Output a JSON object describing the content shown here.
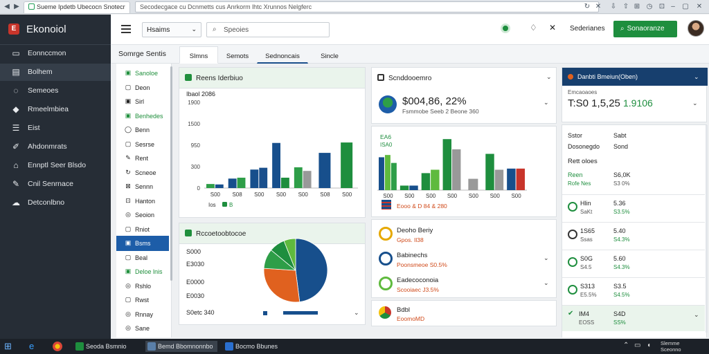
{
  "browser": {
    "tab_title": "Sueme Ipdetb Ubecocn Snotecr",
    "url": "Secodecgace cu Dcnmetts cus Anrkorm lhtc Xrunnos Nelgferc"
  },
  "sidebar": {
    "brand": "Ekonoiol",
    "items": [
      {
        "icon": "dashboard-icon",
        "glyph": "▭",
        "label": "Eonnccmon"
      },
      {
        "icon": "folder-icon",
        "glyph": "▤",
        "label": "Bolhem"
      },
      {
        "icon": "chat-icon",
        "glyph": "◌",
        "label": "Semeoes"
      },
      {
        "icon": "chart-icon",
        "glyph": "◆",
        "label": "Rmeelmbiea"
      },
      {
        "icon": "list-icon",
        "glyph": "☰",
        "label": "Eist"
      },
      {
        "icon": "rocket-icon",
        "glyph": "✐",
        "label": "Ahdonmrats"
      },
      {
        "icon": "car-icon",
        "glyph": "⌂",
        "label": "Ennptl Seer Blsdo"
      },
      {
        "icon": "pen-icon",
        "glyph": "✎",
        "label": "Cnil Senrnace"
      },
      {
        "icon": "cloud-icon",
        "glyph": "☁",
        "label": "Detconlbno"
      }
    ]
  },
  "topbar": {
    "select_value": "Hsaims",
    "search_placeholder": "Speoies",
    "label": "Sederianes",
    "button_label": "Sonaoranze"
  },
  "page": {
    "title": "Somrge Sentis",
    "tabs": [
      "Slmns",
      "Semots",
      "Sednoncais",
      "Sincle"
    ]
  },
  "subnav": [
    {
      "glyph": "▣",
      "label": "Sanoloe",
      "g": true
    },
    {
      "glyph": "▢",
      "label": "Deon",
      "g": false
    },
    {
      "glyph": "▣",
      "label": "Sirl",
      "g": false
    },
    {
      "glyph": "▣",
      "label": "Benhedes",
      "g": true
    },
    {
      "glyph": "◯",
      "label": "Benn",
      "g": false
    },
    {
      "glyph": "▢",
      "label": "Sesrse",
      "g": false
    },
    {
      "glyph": "✎",
      "label": "Rent",
      "g": false
    },
    {
      "glyph": "↻",
      "label": "Scneoe",
      "g": false
    },
    {
      "glyph": "⊠",
      "label": "Sennn",
      "g": false
    },
    {
      "glyph": "⊡",
      "label": "Hanton",
      "g": false
    },
    {
      "glyph": "◎",
      "label": "Seoion",
      "g": false
    },
    {
      "glyph": "▢",
      "label": "Rniot",
      "g": false
    },
    {
      "glyph": "▣",
      "label": "Bsms",
      "g": false,
      "active": true
    },
    {
      "glyph": "▢",
      "label": "Beal",
      "g": false
    },
    {
      "glyph": "▣",
      "label": "Deloe lnis",
      "g": true
    },
    {
      "glyph": "◎",
      "label": "Rshlo",
      "g": false
    },
    {
      "glyph": "▢",
      "label": "Rwst",
      "g": false
    },
    {
      "glyph": "◎",
      "label": "Rnnay",
      "g": false
    },
    {
      "glyph": "◎",
      "label": "Sane",
      "g": false
    }
  ],
  "bar_card": {
    "title": "Reens Iderbiuo",
    "subtitle": "Ibaol 2086",
    "chart_data": {
      "type": "bar",
      "yticks": [
        "1900",
        "1500",
        "950",
        "300",
        "0"
      ],
      "ylim": [
        0,
        1900
      ],
      "categories": [
        "S00",
        "S08",
        "S00",
        "S00",
        "S00",
        "S08",
        "S00"
      ],
      "series": [
        {
          "color": "#2e9e48",
          "values": [
            80,
            0,
            0,
            200,
            360,
            0,
            0
          ]
        },
        {
          "color": "#174f8c",
          "values": [
            0,
            200,
            1530,
            0,
            0,
            600,
            0
          ]
        },
        {
          "color": "#1e8e3e",
          "values": [
            0,
            440,
            0,
            0,
            0,
            0,
            1520
          ]
        },
        {
          "color": "#2e7bd1",
          "values": [
            0,
            0,
            0,
            0,
            0,
            0,
            0
          ]
        }
      ],
      "bars": [
        {
          "cat": 0,
          "v": 90,
          "c": "#2e9e48"
        },
        {
          "cat": 0,
          "v": 80,
          "c": "#174f8c"
        },
        {
          "cat": 1,
          "v": 210,
          "c": "#174f8c"
        },
        {
          "cat": 1,
          "v": 230,
          "c": "#2e9e48"
        },
        {
          "cat": 2,
          "v": 410,
          "c": "#174f8c"
        },
        {
          "cat": 2,
          "v": 450,
          "c": "#1a4f8c"
        },
        {
          "cat": 3,
          "v": 1000,
          "c": "#174f8c"
        },
        {
          "cat": 3,
          "v": 230,
          "c": "#1e8e3e"
        },
        {
          "cat": 4,
          "v": 460,
          "c": "#2e9e48"
        },
        {
          "cat": 4,
          "v": 380,
          "c": "#999999"
        },
        {
          "cat": 5,
          "v": 780,
          "c": "#174f8c"
        },
        {
          "cat": 6,
          "v": 1010,
          "c": "#1e8e3e"
        }
      ],
      "legend": [
        "Ios",
        "B"
      ]
    }
  },
  "pie_card": {
    "title": "Rccoetoobtocoe",
    "labels": [
      "S000",
      "E3030",
      "E0000",
      "E0030"
    ],
    "footer": "S0etc 340",
    "chart_data": {
      "type": "pie",
      "slices": [
        {
          "value": 48,
          "color": "#174f8c"
        },
        {
          "value": 28,
          "color": "#e0611f"
        },
        {
          "value": 10,
          "color": "#2e9e48"
        },
        {
          "value": 8,
          "color": "#1e8e3e"
        },
        {
          "value": 6,
          "color": "#5fba3e"
        }
      ]
    }
  },
  "mid_card": {
    "title": "Scnddooemro",
    "value": "$004,86, 22%",
    "sub": "Fsmmobe Seeb 2 Beone 360",
    "chart_labels": [
      "EA6",
      "ISA0"
    ],
    "chart_data": {
      "type": "bar",
      "ylim": [
        0,
        100
      ],
      "categories": [
        "S00",
        "S00",
        "S00",
        "S00",
        "S00",
        "S00",
        "S00"
      ],
      "bars": [
        {
          "cat": 0,
          "v": 58,
          "c": "#174f8c"
        },
        {
          "cat": 0,
          "v": 62,
          "c": "#5fba3e"
        },
        {
          "cat": 0,
          "v": 48,
          "c": "#2e9e48"
        },
        {
          "cat": 1,
          "v": 8,
          "c": "#1e8e3e"
        },
        {
          "cat": 1,
          "v": 8,
          "c": "#174f8c"
        },
        {
          "cat": 2,
          "v": 30,
          "c": "#1e8e3e"
        },
        {
          "cat": 2,
          "v": 36,
          "c": "#5fba3e"
        },
        {
          "cat": 3,
          "v": 90,
          "c": "#1e8e3e"
        },
        {
          "cat": 3,
          "v": 72,
          "c": "#999999"
        },
        {
          "cat": 4,
          "v": 20,
          "c": "#999999"
        },
        {
          "cat": 5,
          "v": 64,
          "c": "#1e8e3e"
        },
        {
          "cat": 5,
          "v": 36,
          "c": "#999999"
        },
        {
          "cat": 6,
          "v": 38,
          "c": "#174f8c"
        },
        {
          "cat": 6,
          "v": 38,
          "c": "#c8352b"
        }
      ]
    },
    "legend_text": "Eooo & D 84 & 280"
  },
  "mid_list": [
    {
      "title": "Deoho Beriy",
      "sub": "Gpos. Il38",
      "color": "#e6a800"
    },
    {
      "title": "Babinechs",
      "sub": "Poonsmeoe  S0.5%",
      "color": "#174f8c"
    },
    {
      "title": "Eadecoconoia",
      "sub": "Scooiaec  J3.5%",
      "color": "#5fba3e"
    },
    {
      "title": "Bdbl",
      "sub": "EoomoMD",
      "color": "#c8352b"
    }
  ],
  "right_card": {
    "title": "Danbti Bmeiun(Oben)",
    "sub": "Emcaoaoes",
    "value": "T:S0 1,5,25",
    "delta": "1.9106",
    "cols": [
      [
        "Sstor",
        "Sabt"
      ],
      [
        "Dosonegdo",
        "Sond"
      ]
    ],
    "section": "Rett oloes",
    "rows": [
      {
        "a": "Reen",
        "a2": "Rofe Nes",
        "b": "S6,0K",
        "b2": "S3 0%"
      },
      {
        "a": "Hlin",
        "a2": "SaKt",
        "b": "5.36",
        "b2": "S3.5%"
      },
      {
        "a": "1S65",
        "a2": "Ssas",
        "b": "5.40",
        "b2": "S4.3%"
      },
      {
        "a": "S0G",
        "a2": "S4.5",
        "b": "5.60",
        "b2": "S4.3%"
      },
      {
        "a": "S313",
        "a2": "E5.5%",
        "b": "S3.5",
        "b2": "S4.5%"
      },
      {
        "a": "IM4",
        "a2": "EOSS",
        "b": "S4D",
        "b2": "SS%"
      }
    ]
  },
  "taskbar": {
    "items": [
      "Seoda Bsmnio",
      "Bemd Bbomnonnbo",
      "Bocmo Bbunes"
    ],
    "time": "Slemme\nSceonno"
  }
}
